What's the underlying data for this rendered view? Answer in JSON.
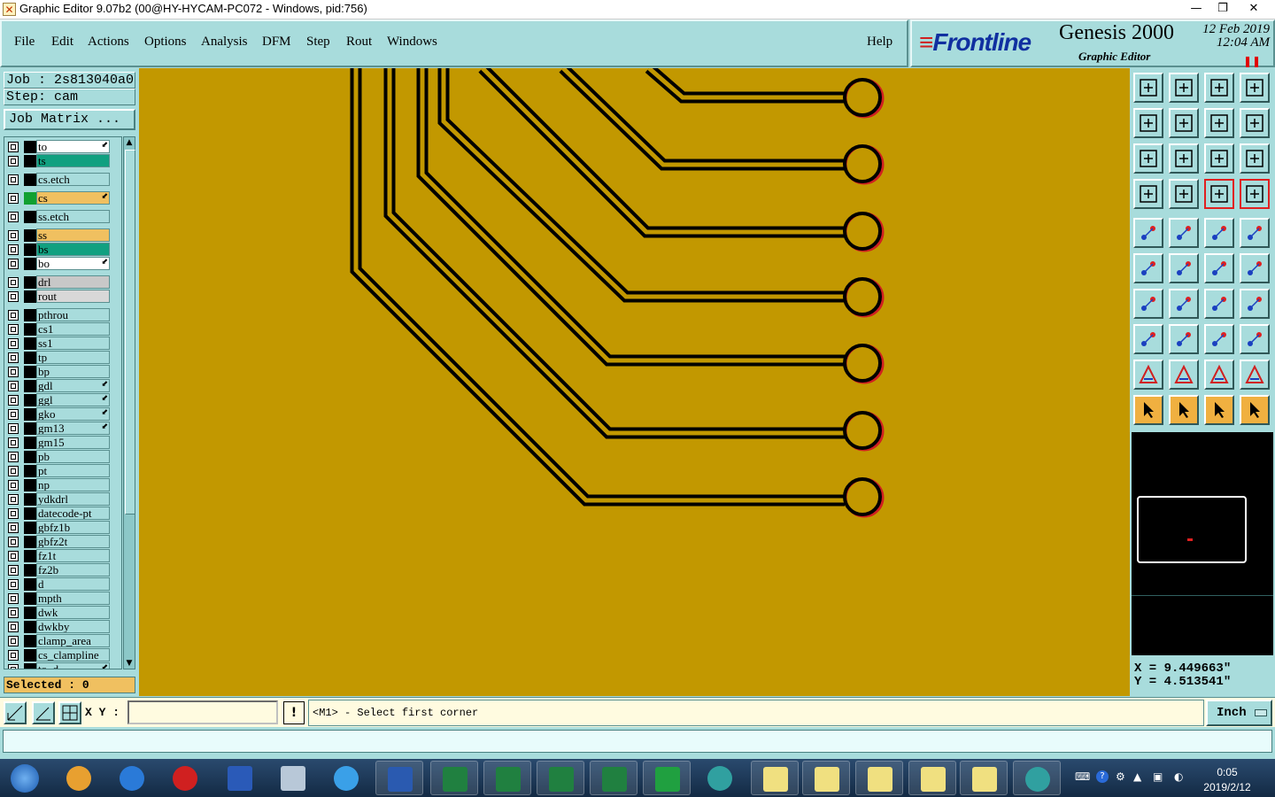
{
  "window": {
    "title": "Graphic Editor 9.07b2 (00@HY-HYCAM-PC072 - Windows, pid:756)"
  },
  "menu": [
    "File",
    "Edit",
    "Actions",
    "Options",
    "Analysis",
    "DFM",
    "Step",
    "Rout",
    "Windows"
  ],
  "help_label": "Help",
  "brand": {
    "logo_f": "F",
    "logo_rest": "rontline",
    "product": "Genesis 2000",
    "date": "12 Feb 2019",
    "time": "12:04 AM",
    "subtitle": "Graphic Editor"
  },
  "job": {
    "job_line": "Job : 2s813040a0",
    "step_line": "Step: cam",
    "matrix_button": "Job Matrix ..."
  },
  "layers": [
    {
      "name": "to",
      "color": "#ffffff",
      "swatch": "#000000",
      "mark": "⬋",
      "group": 0
    },
    {
      "name": "ts",
      "color": "#10a080",
      "swatch": "#000000",
      "mark": "",
      "group": 0
    },
    {
      "name": "cs.etch",
      "color": "#a8dcdc",
      "swatch": "#000000",
      "mark": "",
      "group": 1
    },
    {
      "name": "cs",
      "color": "#f0c060",
      "swatch": "#10a030",
      "mark": "⬋",
      "group": 2
    },
    {
      "name": "ss.etch",
      "color": "#a8dcdc",
      "swatch": "#000000",
      "mark": "",
      "group": 3
    },
    {
      "name": "ss",
      "color": "#f0c060",
      "swatch": "#000000",
      "mark": "",
      "group": 4
    },
    {
      "name": "bs",
      "color": "#10a080",
      "swatch": "#000000",
      "mark": "",
      "group": 4
    },
    {
      "name": "bo",
      "color": "#ffffff",
      "swatch": "#000000",
      "mark": "⬋",
      "group": 4
    },
    {
      "name": "drl",
      "color": "#c8c8c8",
      "swatch": "#000000",
      "mark": "",
      "group": 5
    },
    {
      "name": "rout",
      "color": "#d8d8d8",
      "swatch": "#000000",
      "mark": "",
      "group": 5
    },
    {
      "name": "pthrou",
      "color": "#a8dcdc",
      "swatch": "#000000",
      "mark": "",
      "group": 6
    },
    {
      "name": "cs1",
      "color": "#a8dcdc",
      "swatch": "#000000",
      "mark": "",
      "group": 6
    },
    {
      "name": "ss1",
      "color": "#a8dcdc",
      "swatch": "#000000",
      "mark": "",
      "group": 6
    },
    {
      "name": "tp",
      "color": "#a8dcdc",
      "swatch": "#000000",
      "mark": "",
      "group": 6
    },
    {
      "name": "bp",
      "color": "#a8dcdc",
      "swatch": "#000000",
      "mark": "",
      "group": 6
    },
    {
      "name": "gdl",
      "color": "#a8dcdc",
      "swatch": "#000000",
      "mark": "⬋",
      "group": 6
    },
    {
      "name": "ggl",
      "color": "#a8dcdc",
      "swatch": "#000000",
      "mark": "⬋",
      "group": 6
    },
    {
      "name": "gko",
      "color": "#a8dcdc",
      "swatch": "#000000",
      "mark": "⬋",
      "group": 6
    },
    {
      "name": "gm13",
      "color": "#a8dcdc",
      "swatch": "#000000",
      "mark": "⬋",
      "group": 6
    },
    {
      "name": "gm15",
      "color": "#a8dcdc",
      "swatch": "#000000",
      "mark": "",
      "group": 6
    },
    {
      "name": "pb",
      "color": "#a8dcdc",
      "swatch": "#000000",
      "mark": "",
      "group": 6
    },
    {
      "name": "pt",
      "color": "#a8dcdc",
      "swatch": "#000000",
      "mark": "",
      "group": 6
    },
    {
      "name": "np",
      "color": "#a8dcdc",
      "swatch": "#000000",
      "mark": "",
      "group": 6
    },
    {
      "name": "ydkdrl",
      "color": "#a8dcdc",
      "swatch": "#000000",
      "mark": "",
      "group": 6
    },
    {
      "name": "datecode-pt",
      "color": "#a8dcdc",
      "swatch": "#000000",
      "mark": "",
      "group": 6
    },
    {
      "name": "gbfz1b",
      "color": "#a8dcdc",
      "swatch": "#000000",
      "mark": "",
      "group": 6
    },
    {
      "name": "gbfz2t",
      "color": "#a8dcdc",
      "swatch": "#000000",
      "mark": "",
      "group": 6
    },
    {
      "name": "fz1t",
      "color": "#a8dcdc",
      "swatch": "#000000",
      "mark": "",
      "group": 6
    },
    {
      "name": "fz2b",
      "color": "#a8dcdc",
      "swatch": "#000000",
      "mark": "",
      "group": 6
    },
    {
      "name": "d",
      "color": "#a8dcdc",
      "swatch": "#000000",
      "mark": "",
      "group": 6
    },
    {
      "name": "mpth",
      "color": "#a8dcdc",
      "swatch": "#000000",
      "mark": "",
      "group": 6
    },
    {
      "name": "dwk",
      "color": "#a8dcdc",
      "swatch": "#000000",
      "mark": "",
      "group": 6
    },
    {
      "name": "dwkby",
      "color": "#a8dcdc",
      "swatch": "#000000",
      "mark": "",
      "group": 6
    },
    {
      "name": "clamp_area",
      "color": "#a8dcdc",
      "swatch": "#000000",
      "mark": "",
      "group": 6
    },
    {
      "name": "cs_clampline",
      "color": "#a8dcdc",
      "swatch": "#000000",
      "mark": "",
      "group": 6
    },
    {
      "name": "to_d",
      "color": "#a8dcdc",
      "swatch": "#000000",
      "mark": "⬋",
      "group": 6
    }
  ],
  "selected": "Selected : 0",
  "coords": {
    "x": "X = 9.449663\"",
    "y": "Y = 4.513541\""
  },
  "xy_label": "X Y :",
  "prompt": "<M1> - Select first corner",
  "warn": "!",
  "units": "Inch",
  "clock": {
    "time": "0:05",
    "date": "2019/2/12"
  },
  "colors": {
    "canvas": "#c29800",
    "panel": "#a8dcdc",
    "trace": "#000000",
    "trace_shadow": "#d02020"
  }
}
